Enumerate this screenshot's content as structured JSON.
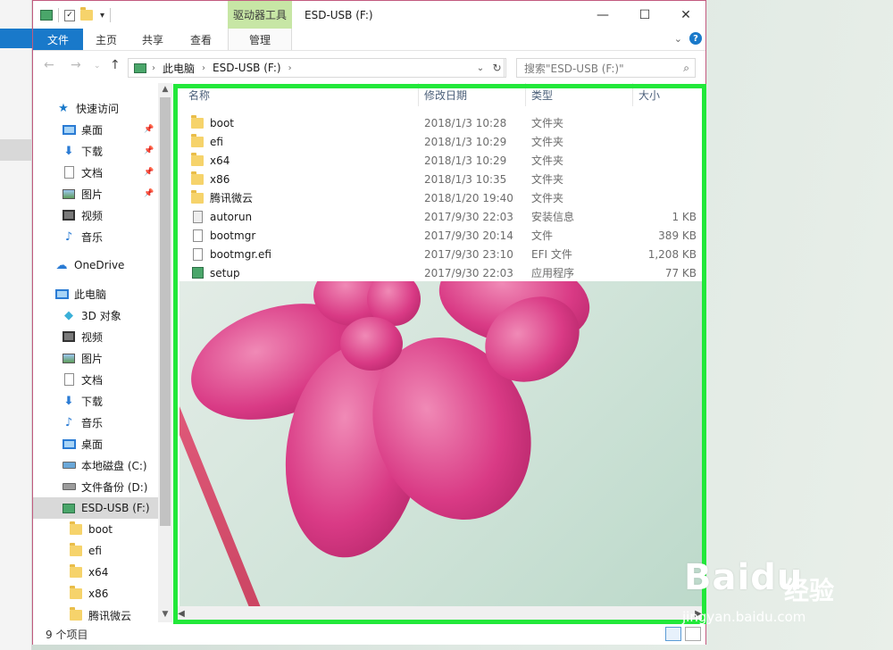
{
  "window": {
    "title": "ESD-USB (F:)",
    "context_tab_group": "驱动器工具",
    "minimize": "—",
    "maximize": "☐",
    "close": "✕"
  },
  "ribbon": {
    "tabs": [
      {
        "label": "文件"
      },
      {
        "label": "主页"
      },
      {
        "label": "共享"
      },
      {
        "label": "查看"
      },
      {
        "label": "管理"
      }
    ],
    "help": "?"
  },
  "address": {
    "crumbs": [
      "此电脑",
      "ESD-USB (F:)"
    ],
    "search_placeholder": "搜索\"ESD-USB (F:)\""
  },
  "sidebar": {
    "quick_access": "快速访问",
    "quick_items": [
      "桌面",
      "下载",
      "文档",
      "图片",
      "视频",
      "音乐"
    ],
    "onedrive": "OneDrive",
    "this_pc": "此电脑",
    "pc_items": [
      "3D 对象",
      "视频",
      "图片",
      "文档",
      "下载",
      "音乐",
      "桌面",
      "本地磁盘 (C:)",
      "文件备份 (D:)",
      "ESD-USB (F:)"
    ],
    "usb_items": [
      "boot",
      "efi",
      "x64",
      "x86",
      "腾讯微云"
    ]
  },
  "columns": {
    "name": "名称",
    "date": "修改日期",
    "type": "类型",
    "size": "大小"
  },
  "files": [
    {
      "name": "boot",
      "date": "2018/1/3 10:28",
      "type": "文件夹",
      "size": "",
      "icon": "folder-icon"
    },
    {
      "name": "efi",
      "date": "2018/1/3 10:29",
      "type": "文件夹",
      "size": "",
      "icon": "folder-icon"
    },
    {
      "name": "x64",
      "date": "2018/1/3 10:29",
      "type": "文件夹",
      "size": "",
      "icon": "folder-icon"
    },
    {
      "name": "x86",
      "date": "2018/1/3 10:35",
      "type": "文件夹",
      "size": "",
      "icon": "folder-icon"
    },
    {
      "name": "腾讯微云",
      "date": "2018/1/20 19:40",
      "type": "文件夹",
      "size": "",
      "icon": "folder-icon"
    },
    {
      "name": "autorun",
      "date": "2017/9/30 22:03",
      "type": "安装信息",
      "size": "1 KB",
      "icon": "settings-file-icon"
    },
    {
      "name": "bootmgr",
      "date": "2017/9/30 20:14",
      "type": "文件",
      "size": "389 KB",
      "icon": "file-icon"
    },
    {
      "name": "bootmgr.efi",
      "date": "2017/9/30 23:10",
      "type": "EFI 文件",
      "size": "1,208 KB",
      "icon": "file-icon"
    },
    {
      "name": "setup",
      "date": "2017/9/30 22:03",
      "type": "应用程序",
      "size": "77 KB",
      "icon": "setup-app-icon"
    }
  ],
  "status": {
    "count": "9 个项目"
  },
  "watermark": {
    "logo": "Baidu",
    "cn": "经验",
    "url": "jingyan.baidu.com"
  },
  "colors": {
    "accent": "#1979ca",
    "highlight": "#22e83a",
    "context_tab": "#c7e6a5"
  }
}
